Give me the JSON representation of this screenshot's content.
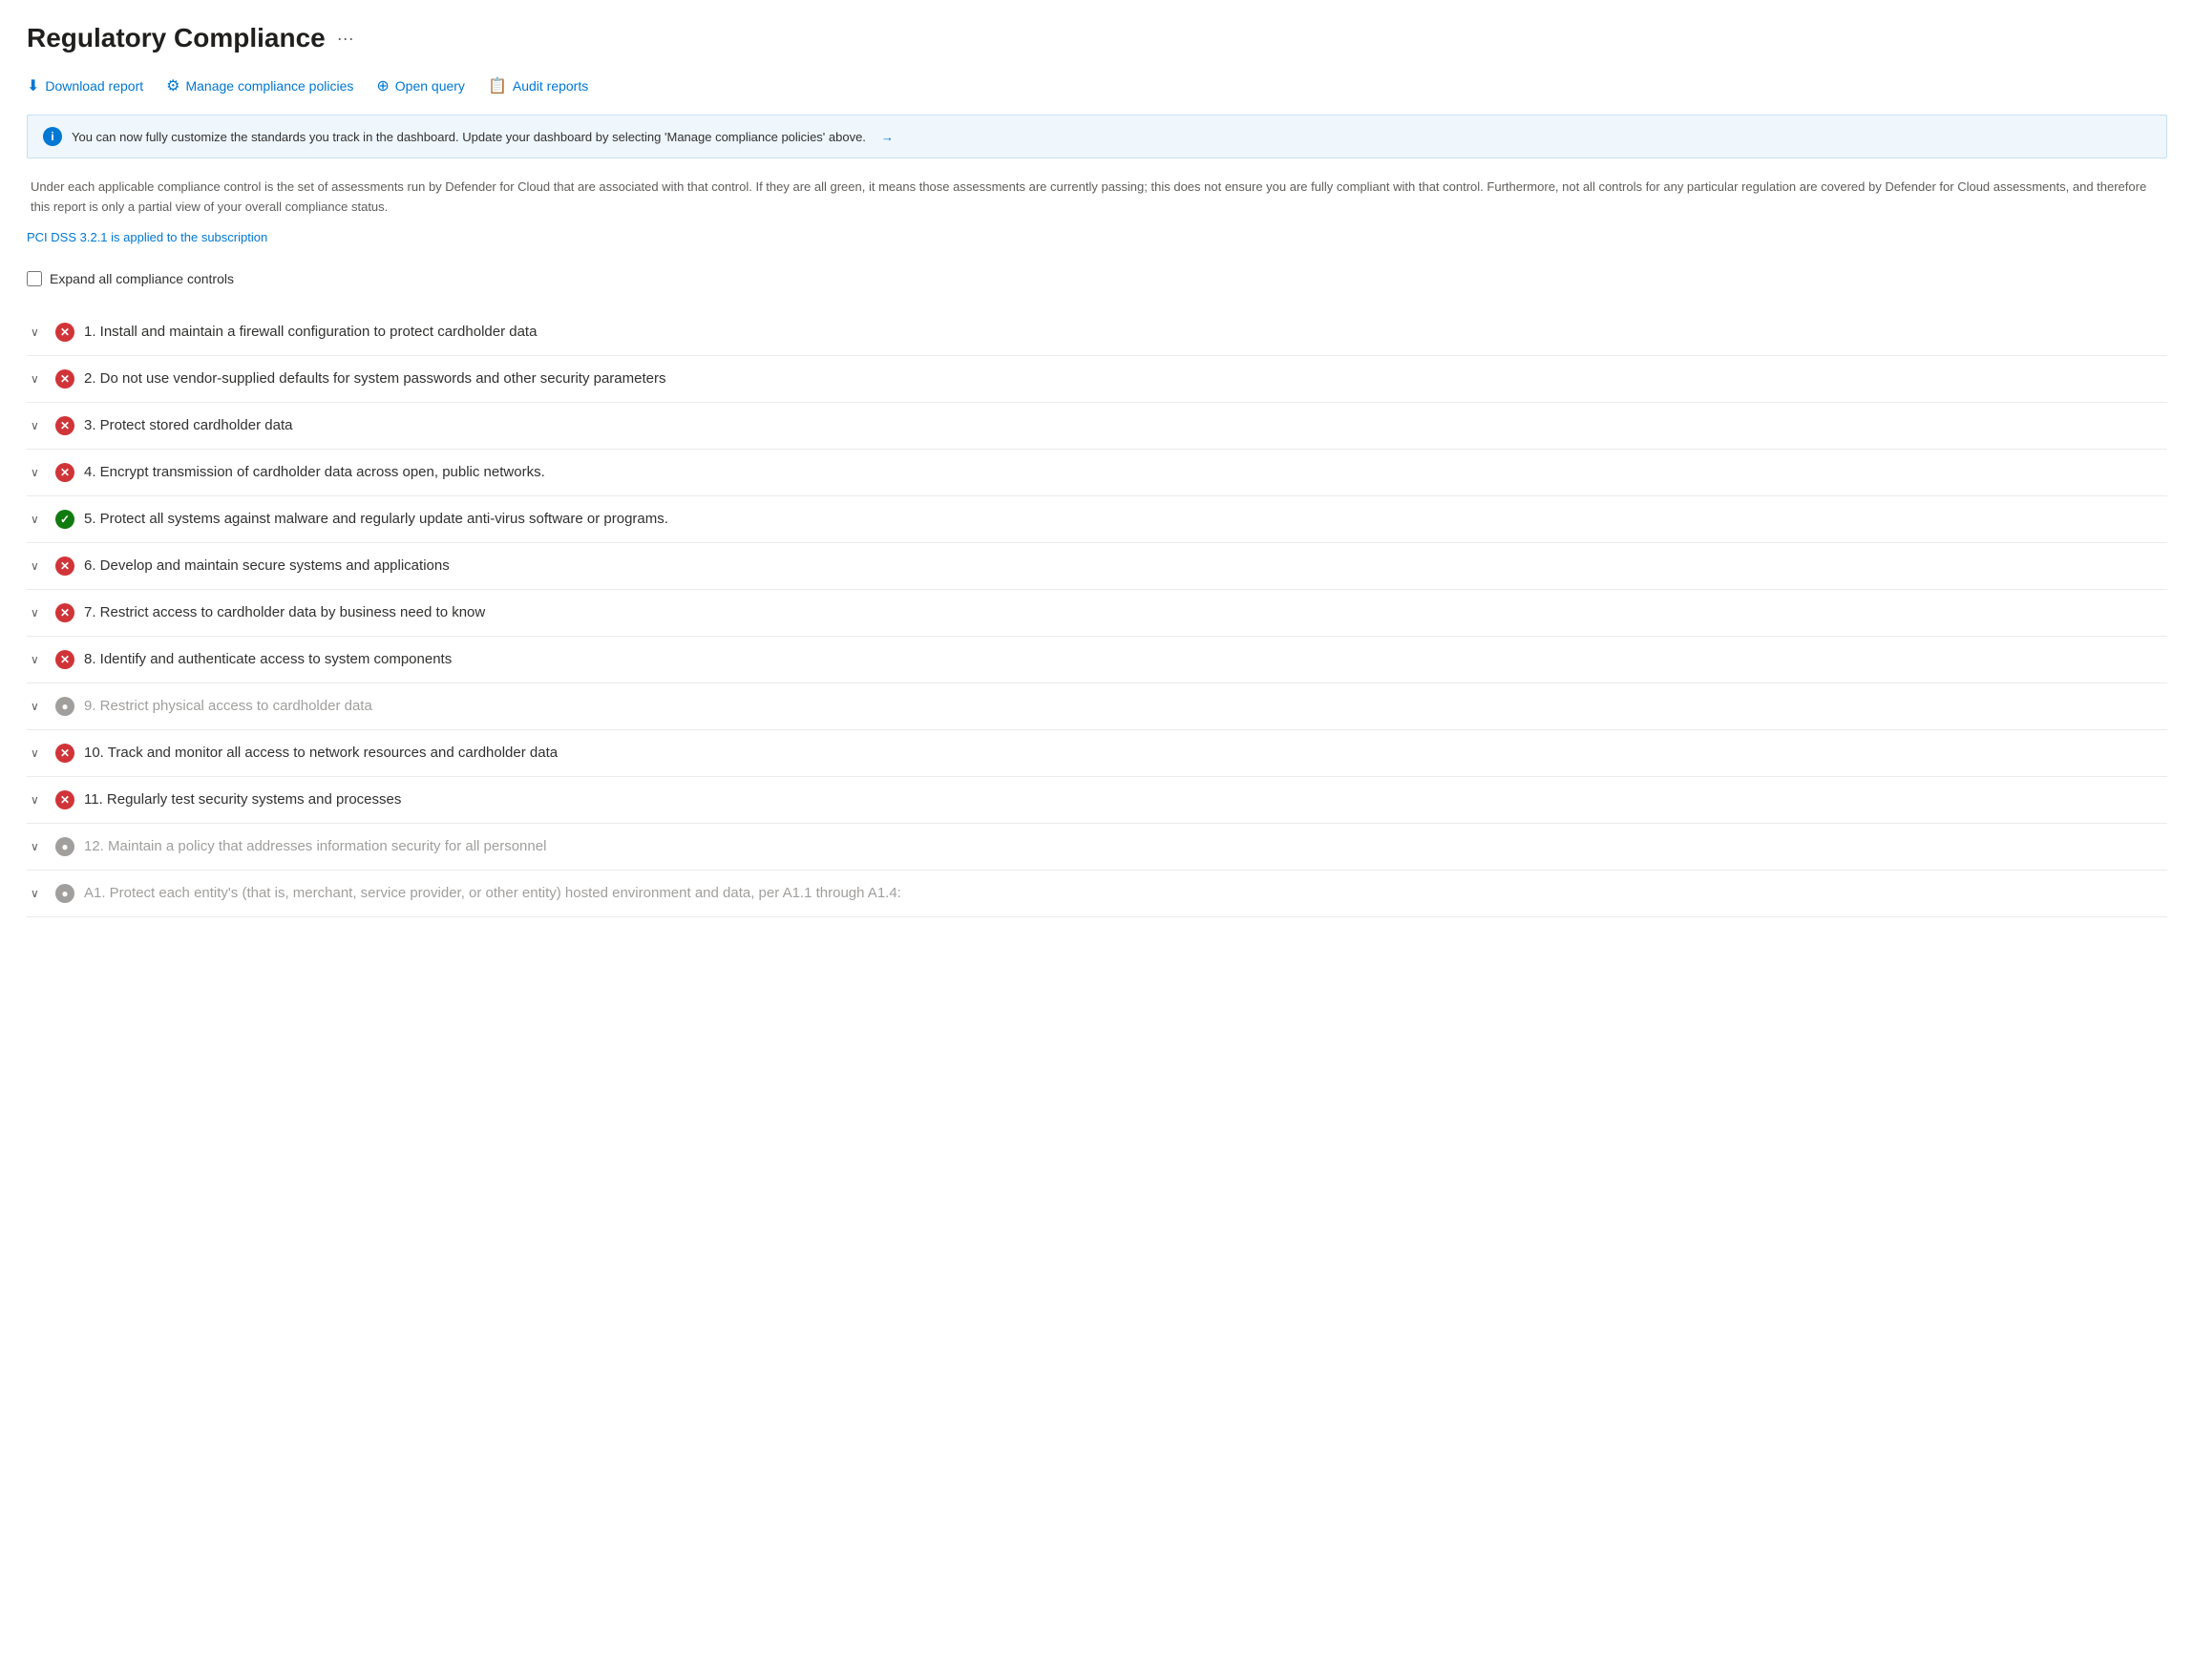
{
  "page": {
    "title": "Regulatory Compliance",
    "ellipsis": "···"
  },
  "toolbar": {
    "download_label": "Download report",
    "manage_label": "Manage compliance policies",
    "query_label": "Open query",
    "audit_label": "Audit reports"
  },
  "banner": {
    "message": "You can now fully customize the standards you track in the dashboard. Update your dashboard by selecting 'Manage compliance policies' above.",
    "arrow": "→"
  },
  "description": "Under each applicable compliance control is the set of assessments run by Defender for Cloud that are associated with that control. If they are all green, it means those assessments are currently passing; this does not ensure you are fully compliant with that control. Furthermore, not all controls for any particular regulation are covered by Defender for Cloud assessments, and therefore this report is only a partial view of your overall compliance status.",
  "pci_link": "PCI DSS 3.2.1 is applied to the subscription",
  "expand_label": "Expand all compliance controls",
  "items": [
    {
      "id": 1,
      "status": "error",
      "text": "1. Install and maintain a firewall configuration to protect cardholder data",
      "grayed": false
    },
    {
      "id": 2,
      "status": "error",
      "text": "2. Do not use vendor-supplied defaults for system passwords and other security parameters",
      "grayed": false
    },
    {
      "id": 3,
      "status": "error",
      "text": "3. Protect stored cardholder data",
      "grayed": false
    },
    {
      "id": 4,
      "status": "error",
      "text": "4. Encrypt transmission of cardholder data across open, public networks.",
      "grayed": false
    },
    {
      "id": 5,
      "status": "success",
      "text": "5. Protect all systems against malware and regularly update anti-virus software or programs.",
      "grayed": false
    },
    {
      "id": 6,
      "status": "error",
      "text": "6. Develop and maintain secure systems and applications",
      "grayed": false
    },
    {
      "id": 7,
      "status": "error",
      "text": "7. Restrict access to cardholder data by business need to know",
      "grayed": false
    },
    {
      "id": 8,
      "status": "error",
      "text": "8. Identify and authenticate access to system components",
      "grayed": false
    },
    {
      "id": 9,
      "status": "gray",
      "text": "9. Restrict physical access to cardholder data",
      "grayed": true
    },
    {
      "id": 10,
      "status": "error",
      "text": "10. Track and monitor all access to network resources and cardholder data",
      "grayed": false
    },
    {
      "id": 11,
      "status": "error",
      "text": "11. Regularly test security systems and processes",
      "grayed": false
    },
    {
      "id": 12,
      "status": "gray",
      "text": "12. Maintain a policy that addresses information security for all personnel",
      "grayed": true
    },
    {
      "id": 13,
      "status": "gray",
      "text": "A1. Protect each entity's (that is, merchant, service provider, or other entity) hosted environment and data, per A1.1 through A1.4:",
      "grayed": true
    }
  ]
}
